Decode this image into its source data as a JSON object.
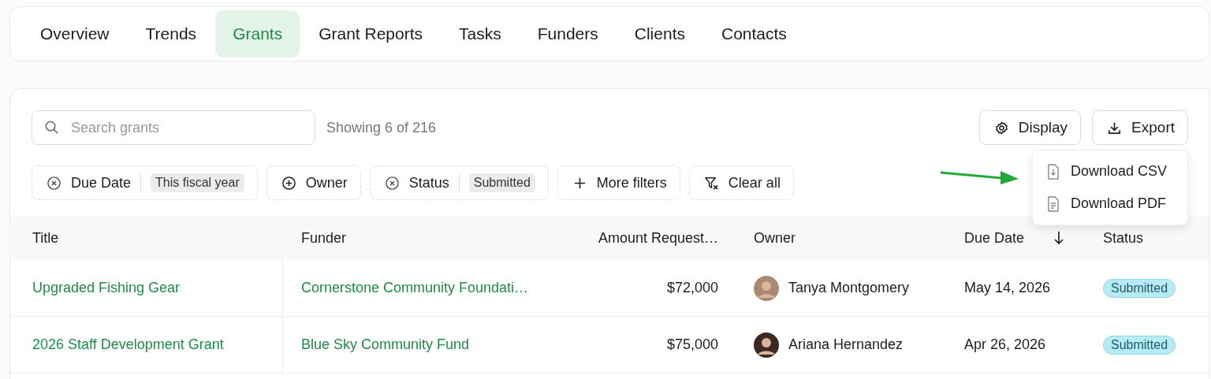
{
  "tabs": [
    {
      "label": "Overview",
      "selected": false
    },
    {
      "label": "Trends",
      "selected": false
    },
    {
      "label": "Grants",
      "selected": true
    },
    {
      "label": "Grant Reports",
      "selected": false
    },
    {
      "label": "Tasks",
      "selected": false
    },
    {
      "label": "Funders",
      "selected": false
    },
    {
      "label": "Clients",
      "selected": false
    },
    {
      "label": "Contacts",
      "selected": false
    }
  ],
  "search": {
    "placeholder": "Search grants"
  },
  "result_count": "Showing 6 of 216",
  "actions": [
    {
      "kind": "display",
      "label": "Display"
    },
    {
      "kind": "export",
      "label": "Export"
    }
  ],
  "export_menu": {
    "open": true,
    "items": [
      {
        "kind": "csv",
        "label": "Download CSV"
      },
      {
        "kind": "pdf",
        "label": "Download PDF"
      }
    ]
  },
  "filters": [
    {
      "kind": "active",
      "label": "Due Date",
      "value": "This fiscal year"
    },
    {
      "kind": "add",
      "label": "Owner"
    },
    {
      "kind": "active",
      "label": "Status",
      "value": "Submitted"
    },
    {
      "kind": "more",
      "label": "More filters"
    },
    {
      "kind": "clear",
      "label": "Clear all"
    }
  ],
  "table": {
    "columns": [
      {
        "label": "Title",
        "sorted": false
      },
      {
        "label": "Funder",
        "sorted": false
      },
      {
        "label": "Amount Request…",
        "sorted": false
      },
      {
        "label": "Owner",
        "sorted": false
      },
      {
        "label": "Due Date",
        "sorted": true
      },
      {
        "label": "Status",
        "sorted": false
      }
    ],
    "rows": [
      {
        "title": "Upgraded Fishing Gear",
        "funder": "Cornerstone Community Foundati…",
        "amount": "$72,000",
        "owner": "Tanya Montgomery",
        "due_date": "May 14, 2026",
        "status": "Submitted"
      },
      {
        "title": "2026 Staff Development Grant",
        "funder": "Blue Sky Community Fund",
        "amount": "$75,000",
        "owner": "Ariana Hernandez",
        "due_date": "Apr 26, 2026",
        "status": "Submitted"
      }
    ]
  }
}
